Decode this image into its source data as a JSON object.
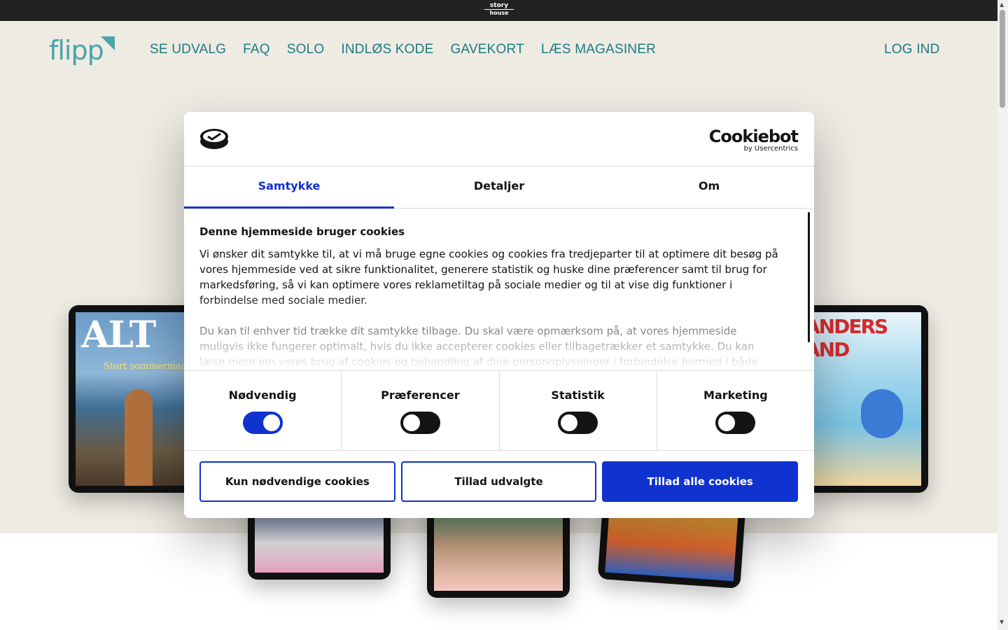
{
  "topbar": {
    "brand_line1": "story",
    "brand_line2": "house"
  },
  "header": {
    "logo_text": "flipp",
    "nav": [
      "SE UDVALG",
      "FAQ",
      "SOLO",
      "INDLØS KODE",
      "GAVEKORT",
      "LÆS MAGASINER"
    ],
    "login": "LOG IND"
  },
  "magazines": {
    "alt_title": "ALT",
    "alt_subtitle": "Stort sommermagasin",
    "ducks_title": "ANDERS AND"
  },
  "colors": {
    "accent": "#1032cf",
    "brand_teal": "#1d7a80",
    "header_bg": "#eeebe3"
  },
  "consent": {
    "brand": "Cookiebot",
    "brand_sub": "by Usercentrics",
    "tabs": [
      "Samtykke",
      "Detaljer",
      "Om"
    ],
    "active_tab": "Samtykke",
    "title": "Denne hjemmeside bruger cookies",
    "paragraph1": "Vi ønsker dit samtykke til, at vi må bruge egne cookies og cookies fra tredjeparter til at optimere dit besøg på vores hjemmeside ved at sikre funktionalitet, generere statistik og huske dine præferencer samt til brug for markedsføring, så vi kan optimere vores reklametiltag på sociale medier og til at vise dig funktioner i forbindelse med sociale medier.",
    "paragraph2": "Du kan til enhver tid trække dit samtykke tilbage. Du skal være opmærksom på, at vores hjemmeside muligvis ikke fungerer optimalt, hvis du ikke accepterer cookies eller tilbagetrækker et samtykke. Du kan læse mere om vores brug af cookies og behandling af dine personoplysninger i forbindelse hermed i både",
    "toggles": [
      {
        "label": "Nødvendig",
        "on": true
      },
      {
        "label": "Præferencer",
        "on": false
      },
      {
        "label": "Statistik",
        "on": false
      },
      {
        "label": "Marketing",
        "on": false
      }
    ],
    "buttons": {
      "necessary_only": "Kun nødvendige cookies",
      "allow_selected": "Tillad udvalgte",
      "allow_all": "Tillad alle cookies"
    }
  }
}
